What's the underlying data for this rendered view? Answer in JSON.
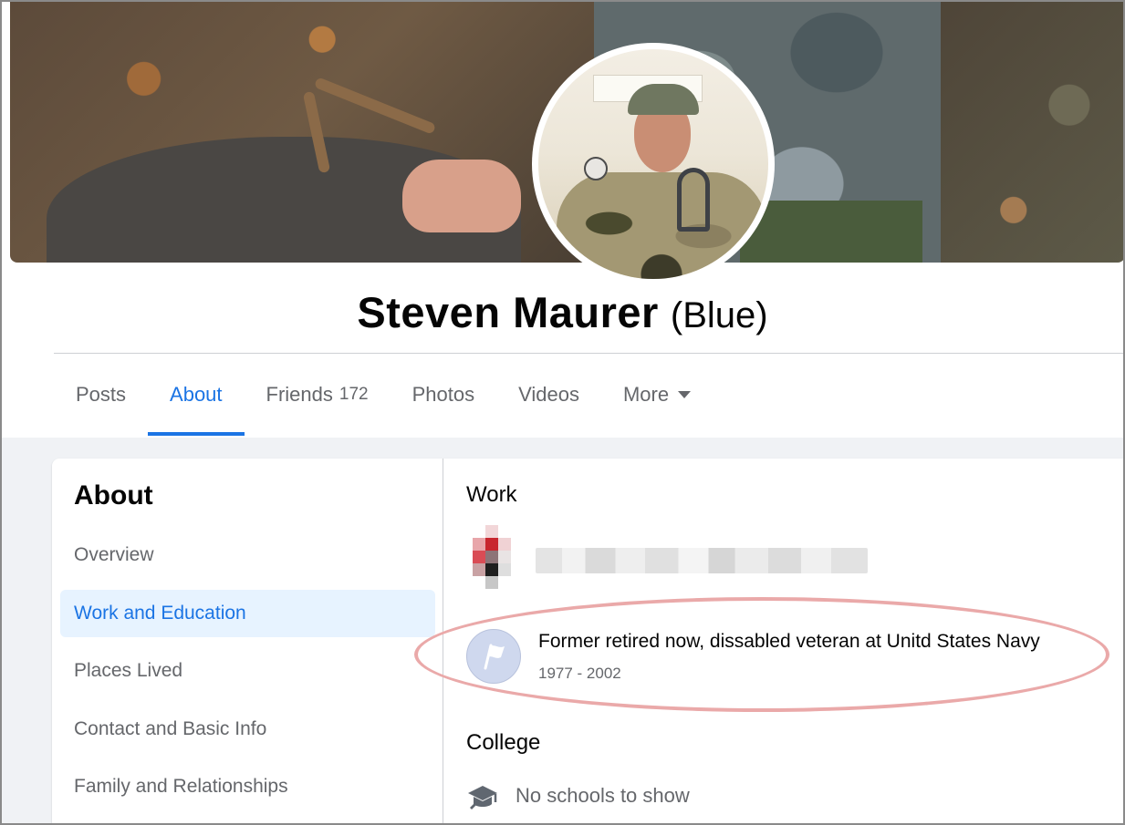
{
  "profile": {
    "name": "Steven Maurer",
    "alternate_name": "(Blue)"
  },
  "tabs": [
    {
      "label": "Posts"
    },
    {
      "label": "About",
      "active": true
    },
    {
      "label": "Friends",
      "count": "172"
    },
    {
      "label": "Photos"
    },
    {
      "label": "Videos"
    },
    {
      "label": "More"
    }
  ],
  "about": {
    "heading": "About",
    "nav": [
      {
        "label": "Overview"
      },
      {
        "label": "Work and Education",
        "active": true
      },
      {
        "label": "Places Lived"
      },
      {
        "label": "Contact and Basic Info"
      },
      {
        "label": "Family and Relationships"
      }
    ]
  },
  "work": {
    "heading": "Work",
    "jobs": [
      {
        "title": "Former retired now, dissabled veteran at Unitd States Navy",
        "years": "1977 - 2002"
      }
    ]
  },
  "college": {
    "heading": "College",
    "empty_text": "No schools to show"
  },
  "colors": {
    "accent": "#1b74e4",
    "annotation_ellipse": "#eaa9a9"
  },
  "icons": [
    "caret-down-icon",
    "flag-icon",
    "graduation-cap-icon"
  ]
}
